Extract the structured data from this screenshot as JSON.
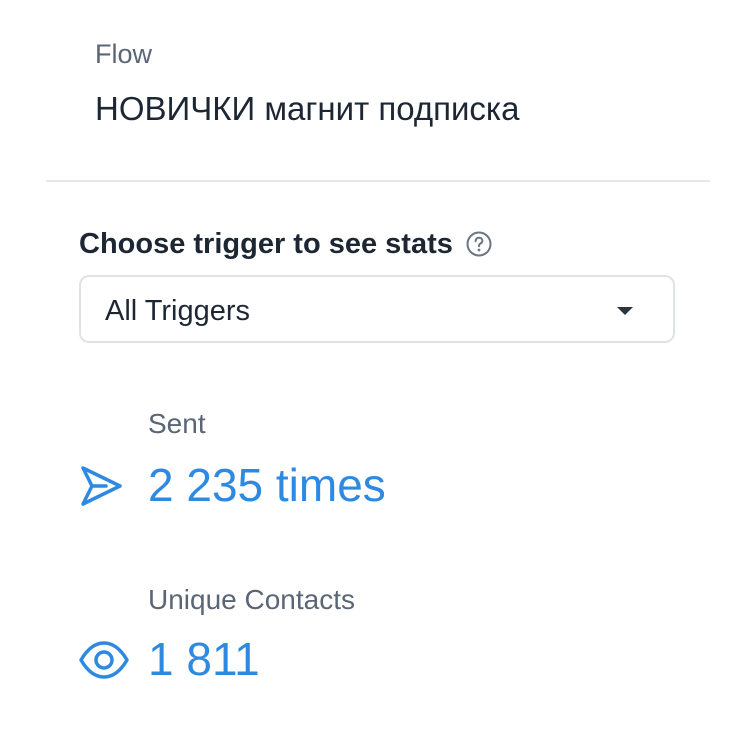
{
  "flow": {
    "label": "Flow",
    "name": "НОВИЧКИ магнит подписка"
  },
  "trigger": {
    "heading": "Choose trigger to see stats",
    "help_icon": "question-circle-icon",
    "selected": "All Triggers",
    "caret_icon": "caret-down-icon"
  },
  "stats": {
    "sent": {
      "label": "Sent",
      "value": "2 235 times",
      "icon": "send-icon"
    },
    "unique": {
      "label": "Unique Contacts",
      "value": "1 811",
      "icon": "eye-icon"
    }
  },
  "colors": {
    "accent": "#2d8ae0",
    "muted_text": "#5a6675",
    "primary_text": "#1c2733",
    "divider": "#e3e6ea",
    "border": "#dfe3e8"
  }
}
